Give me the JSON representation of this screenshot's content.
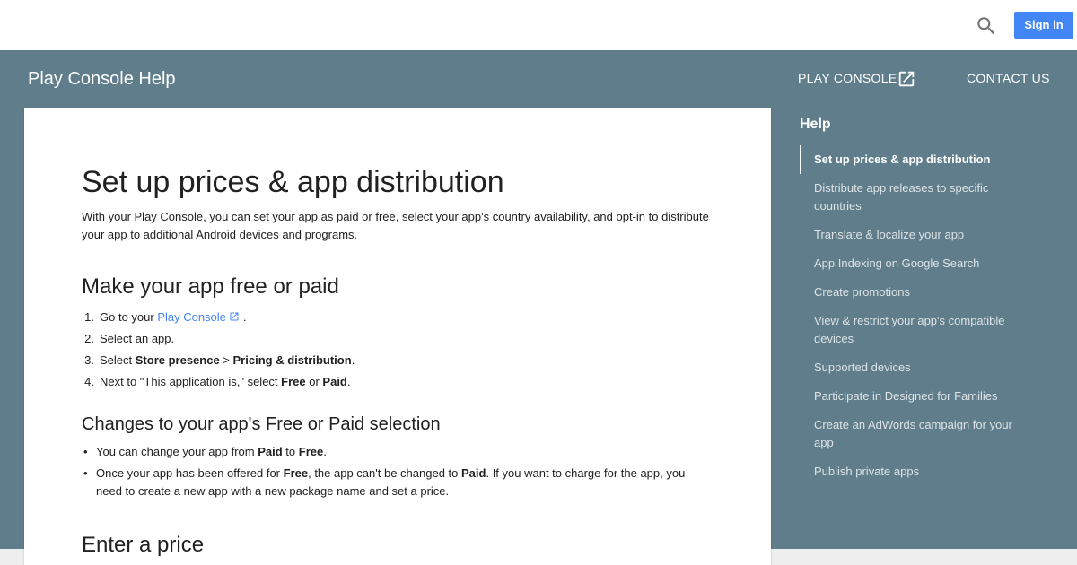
{
  "topbar": {
    "search_icon": "search-icon",
    "signin_label": "Sign in"
  },
  "header": {
    "product_title": "Play Console Help",
    "nav": {
      "play_console": "PLAY CONSOLE",
      "play_console_icon": "open-in-new-icon",
      "contact_us": "CONTACT US"
    }
  },
  "article": {
    "title": "Set up prices & app distribution",
    "intro": "With your Play Console, you can set your app as paid or free, select your app's country availability, and opt-in to distribute your app to additional Android devices and programs.",
    "section1": {
      "heading": "Make your app free or paid",
      "steps": [
        {
          "num": "1.",
          "pre": "Go to your ",
          "link": "Play Console",
          "post": "."
        },
        {
          "num": "2.",
          "text": "Select an app."
        },
        {
          "num": "3.",
          "pre": "Select ",
          "b1": "Store presence",
          "mid": " > ",
          "b2": "Pricing & distribution",
          "post": "."
        },
        {
          "num": "4.",
          "pre": "Next to \"This application is,\" select ",
          "b1": "Free",
          "mid": " or ",
          "b2": "Paid",
          "post": "."
        }
      ]
    },
    "section2": {
      "heading": "Changes to your app's Free or Paid selection",
      "bullets": [
        {
          "pre": "You can change your app from ",
          "b1": "Paid",
          "mid": " to ",
          "b2": "Free",
          "post": "."
        },
        {
          "pre": "Once your app has been offered for ",
          "b1": "Free",
          "mid": ", the app can't be changed to ",
          "b2": "Paid",
          "post": ". If you want to charge for the app, you need to create a new app with a new package name and set a price."
        }
      ]
    },
    "section3": {
      "heading": "Enter a price"
    }
  },
  "help_nav": {
    "heading": "Help",
    "items": [
      {
        "label": "Set up prices & app distribution",
        "active": true
      },
      {
        "label": "Distribute app releases to specific countries"
      },
      {
        "label": "Translate & localize your app"
      },
      {
        "label": "App Indexing on Google Search"
      },
      {
        "label": "Create promotions"
      },
      {
        "label": "View & restrict your app's compatible devices"
      },
      {
        "label": "Supported devices"
      },
      {
        "label": "Participate in Designed for Families"
      },
      {
        "label": "Create an AdWords campaign for your app"
      },
      {
        "label": "Publish private apps"
      }
    ]
  },
  "colors": {
    "header_band": "#607d8b",
    "signin_button": "#4285f4",
    "link": "#4285f4"
  }
}
